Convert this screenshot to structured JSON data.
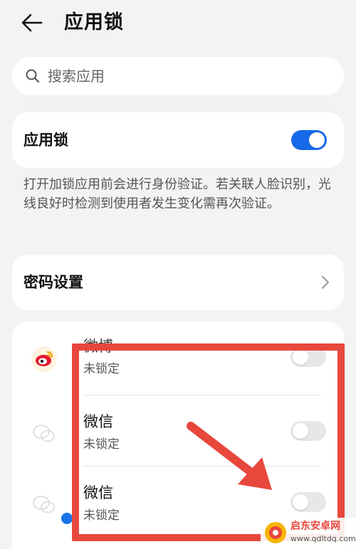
{
  "header": {
    "title": "应用锁",
    "back_icon": "arrow-left-icon"
  },
  "search": {
    "placeholder": "搜索应用",
    "icon": "search-icon"
  },
  "app_lock": {
    "label": "应用锁",
    "enabled": true
  },
  "description": "打开加锁应用前会进行身份验证。若关联人脸识别，光线良好时检测到使用者发生变化需再次验证。",
  "password_settings": {
    "label": "密码设置",
    "icon": "chevron-right-icon"
  },
  "apps": [
    {
      "name": "微博",
      "status": "未锁定",
      "locked": false,
      "icon": "weibo-icon"
    },
    {
      "name": "微信",
      "status": "未锁定",
      "locked": false,
      "icon": "wechat-icon"
    },
    {
      "name": "微信",
      "status": "未锁定",
      "locked": false,
      "icon": "wechat-clone-icon"
    }
  ],
  "watermark": {
    "name": "启东安卓网",
    "url": "www.qdltdq.com"
  },
  "colors": {
    "accent": "#1669e8",
    "annotation": "#e8473c",
    "background": "#f1f3f5"
  }
}
